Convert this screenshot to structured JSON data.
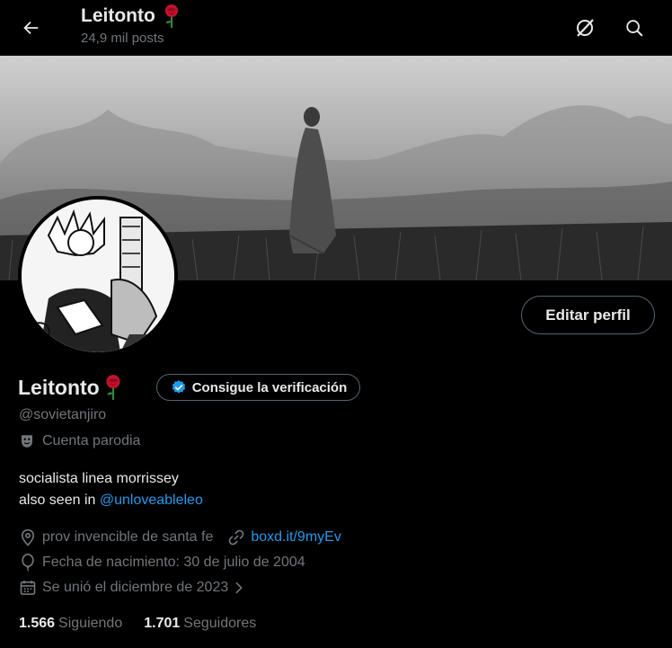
{
  "header": {
    "name": "Leitonto",
    "posts_count": "24,9 mil posts"
  },
  "profile": {
    "display_name": "Leitonto",
    "handle": "@sovietanjiro",
    "label_account_type": "Cuenta parodia",
    "verify_button": "Consigue la verificación",
    "edit_profile_button": "Editar perfil"
  },
  "bio": {
    "line1": "socialista linea morrissey",
    "line2_prefix": "also seen in ",
    "line2_mention": "@unloveableleo"
  },
  "meta": {
    "location": "prov invencible de santa fe",
    "website": "boxd.it/9myEv",
    "birthdate": "Fecha de nacimiento: 30 de julio de 2004",
    "joined": "Se unió el diciembre de 2023"
  },
  "stats": {
    "following_count": "1.566",
    "following_label": "Siguiendo",
    "followers_count": "1.701",
    "followers_label": "Seguidores"
  },
  "colors": {
    "accent": "#1d9bf0",
    "background": "#000000",
    "muted_text": "#71767b",
    "border": "#536471",
    "rose": "#c8102e"
  },
  "icons": {
    "back": "arrow-left-icon",
    "grok": "grok-icon",
    "search": "search-icon",
    "verified": "verified-badge-icon",
    "parody": "theater-mask-icon",
    "location": "location-pin-icon",
    "link": "link-icon",
    "birthday": "balloon-icon",
    "calendar": "calendar-icon",
    "chevron": "chevron-right-icon"
  }
}
